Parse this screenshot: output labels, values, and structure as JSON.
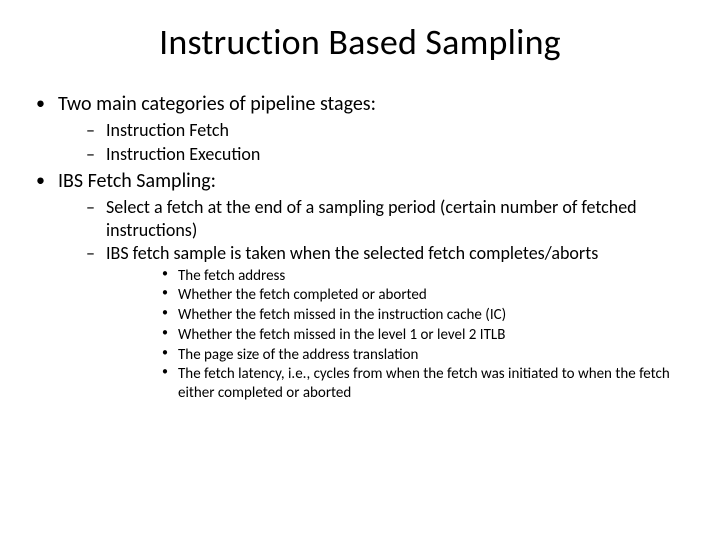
{
  "title": "Instruction Based Sampling",
  "bullets": [
    {
      "text": "Two main categories of pipeline stages:",
      "sub": [
        {
          "text": "Instruction Fetch"
        },
        {
          "text": "Instruction Execution"
        }
      ]
    },
    {
      "text": "IBS Fetch Sampling:",
      "sub": [
        {
          "text": "Select a fetch at the end of a sampling period (certain number of fetched instructions)"
        },
        {
          "text": "IBS fetch sample is taken when the selected fetch completes/aborts",
          "sub": [
            {
              "text": "The fetch address"
            },
            {
              "text": "Whether the fetch completed or aborted"
            },
            {
              "text": "Whether the fetch missed in  the instruction cache (IC)"
            },
            {
              "text": "Whether the fetch missed in the level 1 or level 2 ITLB"
            },
            {
              "text": "The page size of the address translation"
            },
            {
              "text": "The fetch latency, i.e., cycles from when the fetch was initiated to when the fetch either completed or aborted"
            }
          ]
        }
      ]
    }
  ]
}
